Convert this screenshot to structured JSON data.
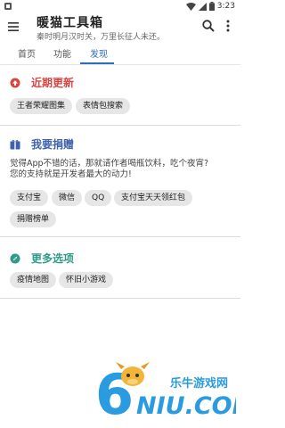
{
  "status_bar": {
    "time": "3:23"
  },
  "app_bar": {
    "title": "暖猫工具箱",
    "subtitle": "秦时明月汉时关，万里长征人未还。"
  },
  "tabs": [
    {
      "label": "首页"
    },
    {
      "label": "功能"
    },
    {
      "label": "发现"
    }
  ],
  "sections": {
    "recent": {
      "title": "近期更新",
      "color": "#d84545",
      "chips": [
        "王者荣耀图集",
        "表情包搜索"
      ]
    },
    "donate": {
      "title": "我要捐赠",
      "color": "#3f63a8",
      "description_line1": "觉得App不错的话，那就请作者喝瓶饮料，吃个夜宵?",
      "description_line2": "您的支持就是开发者最大的动力!",
      "chips": [
        "支付宝",
        "微信",
        "QQ",
        "支付宝天天领红包",
        "捐赠榜单"
      ]
    },
    "more": {
      "title": "更多选项",
      "color": "#2e9b8a",
      "chips": [
        "疫情地图",
        "怀旧小游戏"
      ]
    }
  },
  "watermark": {
    "brand": "乐牛游戏网",
    "domain": "NIU.COM",
    "digit": "6"
  }
}
